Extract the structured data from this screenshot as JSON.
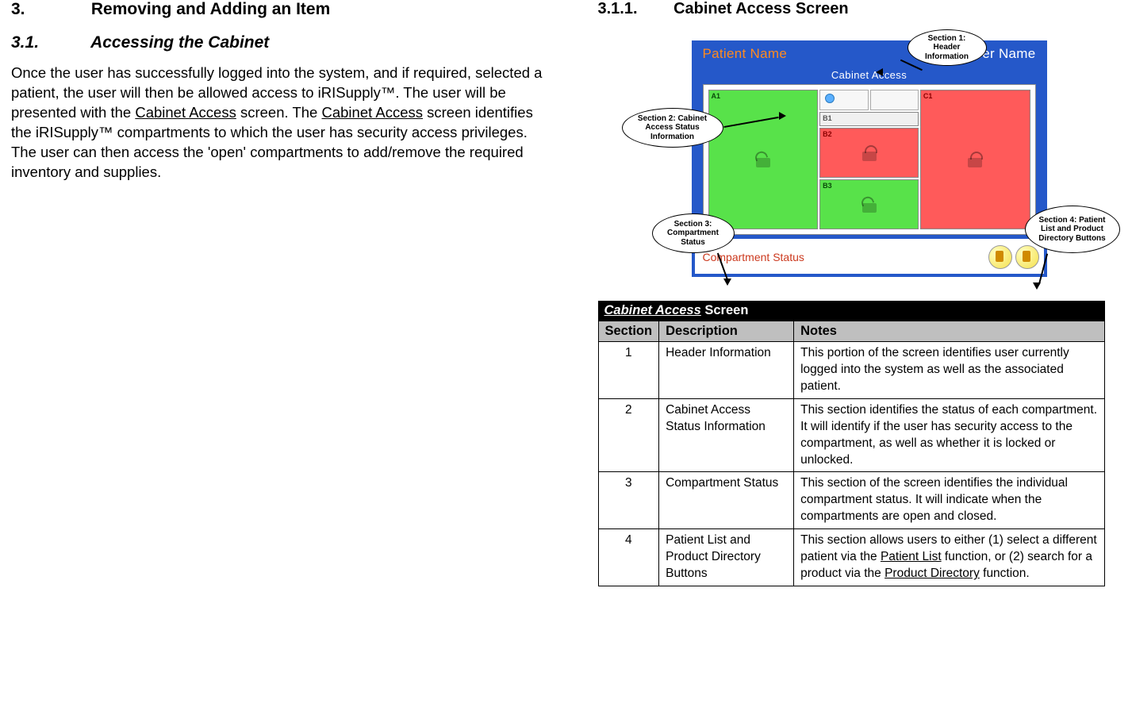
{
  "left": {
    "h_num": "3.",
    "h_text": "Removing and Adding an Item",
    "sub_num": "3.1.",
    "sub_text": "Accessing the Cabinet",
    "para_1a": "Once the user has successfully logged into the system, and if required, selected a patient, the user will then be allowed access to iRISupply™.  The user will be presented with the ",
    "para_1b_u": "Cabinet Access",
    "para_1c": " screen.  The ",
    "para_1d_u": "Cabinet Access",
    "para_1e": " screen identifies the iRISupply™ compartments to which the user has security access privileges.  The user can then access the 'open' compartments to add/remove the required inventory and supplies."
  },
  "right": {
    "h_num": "3.1.1.",
    "h_text": "Cabinet Access Screen"
  },
  "diagram": {
    "header_left": "Patient Name",
    "header_right": "User Name",
    "body_title": "Cabinet Access",
    "footer_status": "Compartment Status",
    "labels": {
      "a1": "A1",
      "b1": "B1",
      "b2": "B2",
      "b3": "B3",
      "c1": "C1"
    },
    "callout1": "Section 1: Header Information",
    "callout2": "Section 2: Cabinet Access Status Information",
    "callout3": "Section 3: Compartment Status",
    "callout4": "Section 4: Patient List and Product Directory Buttons"
  },
  "table": {
    "caption_u": "Cabinet Access",
    "caption_rest": " Screen",
    "head": {
      "c1": "Section",
      "c2": "Description",
      "c3": "Notes"
    },
    "rows": [
      {
        "sec": "1",
        "desc": "Header Information",
        "note": "This portion of the screen identifies user currently logged into the system as well as the associated patient."
      },
      {
        "sec": "2",
        "desc": "Cabinet Access Status Information",
        "note": "This section identifies the status of each compartment.  It will identify if the user has security access to the compartment, as well as whether it is locked or unlocked."
      },
      {
        "sec": "3",
        "desc": "Compartment Status",
        "note": "This section of the screen identifies the individual compartment status.  It will indicate when the compartments are open and closed."
      },
      {
        "sec": "4",
        "desc": "Patient List and Product Directory Buttons",
        "note_a": "This section allows users to either (1) select a different patient via the ",
        "note_b_u": "Patient List",
        "note_c": " function, or (2) search for a product via the ",
        "note_d_u": "Product Directory",
        "note_e": " function."
      }
    ]
  }
}
